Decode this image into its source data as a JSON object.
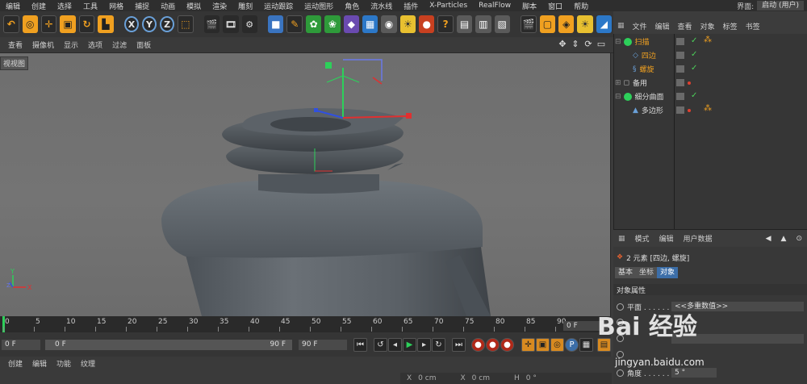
{
  "menubar": {
    "items": [
      "编辑",
      "创建",
      "选择",
      "工具",
      "网格",
      "捕捉",
      "动画",
      "模拟",
      "渲染",
      "雕刻",
      "运动跟踪",
      "运动图形",
      "角色",
      "流水线",
      "插件",
      "X-Particles",
      "RealFlow",
      "脚本",
      "窗口",
      "帮助"
    ],
    "layout_label": "界面:",
    "layout_value": "启动 (用户)"
  },
  "viewport": {
    "menu": [
      "查看",
      "摄像机",
      "显示",
      "选项",
      "过滤",
      "面板"
    ],
    "label": "视视图",
    "axis_y": "Y",
    "axis_x": "X",
    "axis_z": "Z"
  },
  "timeline": {
    "ticks": [
      "0",
      "5",
      "10",
      "15",
      "20",
      "25",
      "30",
      "35",
      "40",
      "45",
      "50",
      "55",
      "60",
      "65",
      "70",
      "75",
      "80",
      "85",
      "90"
    ],
    "current_frame": "0 F"
  },
  "transport": {
    "start_frame": "0 F",
    "range_start": "0 F",
    "range_end": "90 F",
    "end_frame": "90 F"
  },
  "bottom": {
    "menu": [
      "创建",
      "编辑",
      "功能",
      "纹理"
    ],
    "coords": {
      "x_label": "X",
      "x_val": "0 cm",
      "x2_label": "X",
      "x2_val": "0 cm",
      "h_label": "H",
      "h_val": "0 °"
    }
  },
  "object_manager": {
    "menu": [
      "文件",
      "编辑",
      "查看",
      "对象",
      "标签",
      "书签"
    ],
    "objects": [
      {
        "name": "扫描",
        "selected": true
      },
      {
        "name": "四边",
        "selected": true
      },
      {
        "name": "螺旋",
        "selected": true
      },
      {
        "name": "备用",
        "selected": false
      },
      {
        "name": "细分曲面",
        "selected": false
      },
      {
        "name": "多边形",
        "selected": false
      }
    ]
  },
  "attributes": {
    "menu": [
      "模式",
      "编辑",
      "用户数据"
    ],
    "summary": "2 元素 [四边, 螺旋]",
    "tabs": [
      "基本",
      "坐标",
      "对象"
    ],
    "section": "对象属性",
    "rows": [
      {
        "label": "平面 . . . . . . . .",
        "value": "<<多重数值>>"
      },
      {
        "label": "角度 . . . . . . . .",
        "value": "5 °"
      }
    ]
  },
  "watermark": {
    "logo_text": "Bai 经验",
    "url": "jingyan.baidu.com"
  },
  "colors": {
    "accent_orange": "#f0a020",
    "selection_blue": "#3c6ea8",
    "check_green": "#4cd05a",
    "playhead_green": "#2dd05a"
  }
}
